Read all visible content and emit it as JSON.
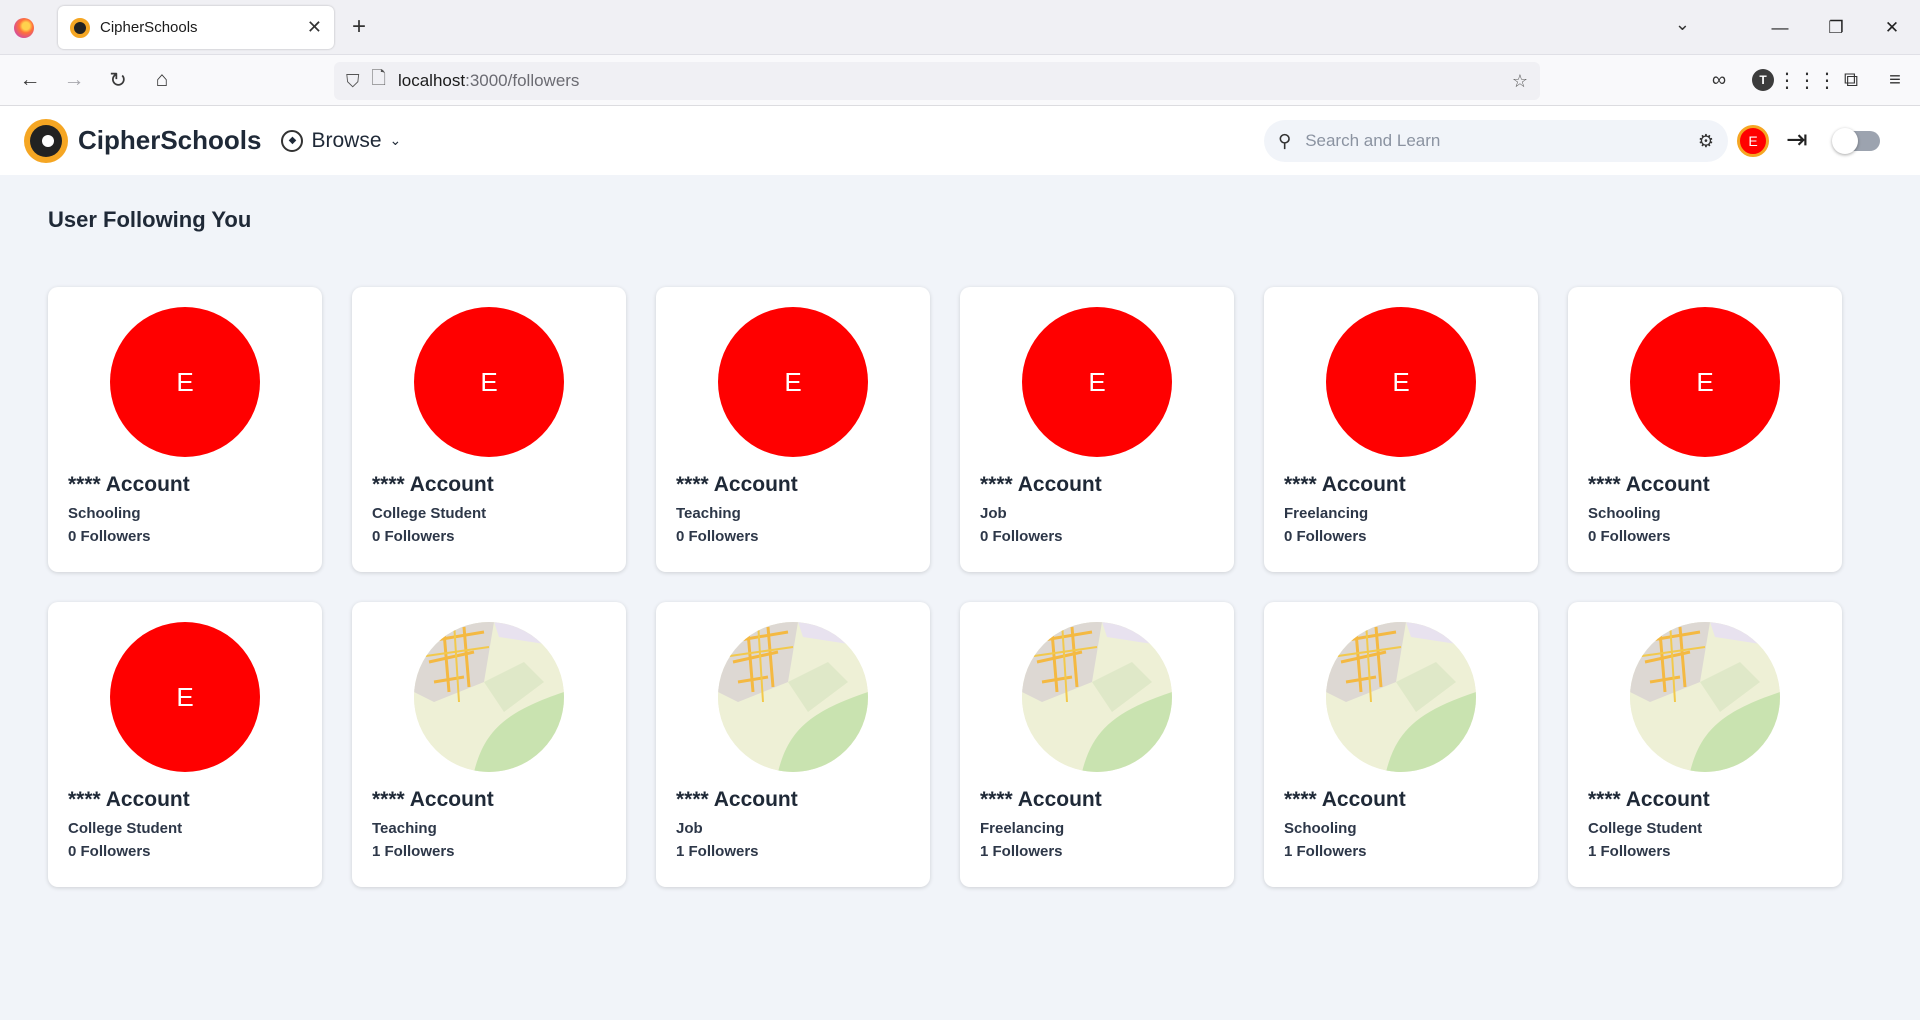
{
  "browser": {
    "tab_title": "CipherSchools",
    "url_host": "localhost",
    "url_path": ":3000/followers",
    "account_initial": "T"
  },
  "header": {
    "brand": "CipherSchools",
    "browse_label": "Browse",
    "search_placeholder": "Search and Learn",
    "avatar_initial": "E"
  },
  "page": {
    "title": "User Following You"
  },
  "cards": [
    {
      "initial": "E",
      "name": "**** Account",
      "role": "Schooling",
      "followers": "0 Followers"
    },
    {
      "initial": "E",
      "name": "**** Account",
      "role": "College Student",
      "followers": "0 Followers"
    },
    {
      "initial": "E",
      "name": "**** Account",
      "role": "Teaching",
      "followers": "0 Followers"
    },
    {
      "initial": "E",
      "name": "**** Account",
      "role": "Job",
      "followers": "0 Followers"
    },
    {
      "initial": "E",
      "name": "**** Account",
      "role": "Freelancing",
      "followers": "0 Followers"
    },
    {
      "initial": "E",
      "name": "**** Account",
      "role": "Schooling",
      "followers": "0 Followers"
    },
    {
      "initial": "E",
      "name": "**** Account",
      "role": "College Student",
      "followers": "0 Followers"
    },
    {
      "initial": "",
      "name": "**** Account",
      "role": "Teaching",
      "followers": "1 Followers"
    },
    {
      "initial": "",
      "name": "**** Account",
      "role": "Job",
      "followers": "1 Followers"
    },
    {
      "initial": "",
      "name": "**** Account",
      "role": "Freelancing",
      "followers": "1 Followers"
    },
    {
      "initial": "",
      "name": "**** Account",
      "role": "Schooling",
      "followers": "1 Followers"
    },
    {
      "initial": "",
      "name": "**** Account",
      "role": "College Student",
      "followers": "1 Followers"
    }
  ]
}
